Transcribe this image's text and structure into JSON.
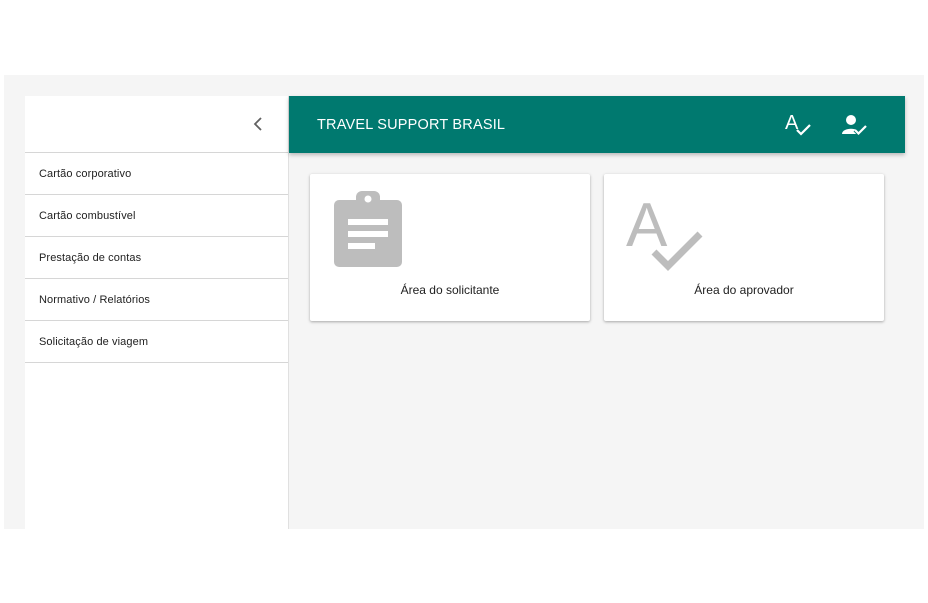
{
  "app": {
    "title": "TRAVEL SUPPORT BRASIL"
  },
  "sidebar": {
    "collapse_icon": "chevron-left-icon",
    "items": [
      {
        "label": "Cartão corporativo"
      },
      {
        "label": "Cartão combustível"
      },
      {
        "label": "Prestação de contas"
      },
      {
        "label": "Normativo / Relatórios"
      },
      {
        "label": "Solicitação de viagem"
      }
    ]
  },
  "header": {
    "icons": [
      "spellcheck-icon",
      "person-check-icon"
    ]
  },
  "cards": [
    {
      "label": "Área do solicitante",
      "icon": "clipboard-icon"
    },
    {
      "label": "Área do aprovador",
      "icon": "spellcheck-icon"
    }
  ],
  "colors": {
    "header": "#00796f",
    "background": "#f5f5f5",
    "icon_gray": "#bdbdbd"
  }
}
